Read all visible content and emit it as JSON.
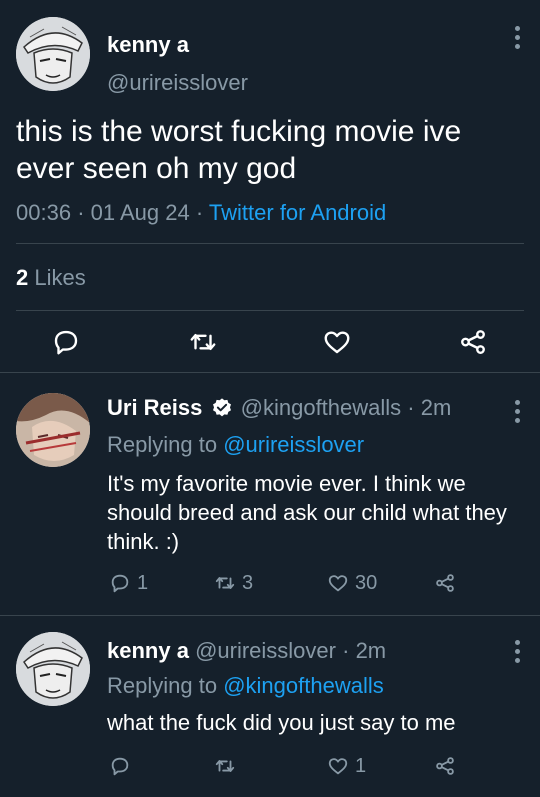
{
  "main_tweet": {
    "author_name": "kenny a",
    "author_handle": "@urireisslover",
    "text": "this is the worst fucking movie ive ever seen oh my god",
    "time": "00:36",
    "date": "01 Aug 24",
    "source": "Twitter for Android",
    "likes_count": "2",
    "likes_label": "Likes"
  },
  "replies": [
    {
      "author_name": "Uri Reiss",
      "verified": true,
      "author_handle": "@kingofthewalls",
      "age": "2m",
      "replying_prefix": "Replying to",
      "replying_to": "@urireisslover",
      "text": "It's my favorite movie ever. I think we should breed and ask our child what they think. :)",
      "reply_count": "1",
      "retweet_count": "3",
      "like_count": "30"
    },
    {
      "author_name": "kenny a",
      "author_handle": "@urireisslover",
      "age": "2m",
      "replying_prefix": "Replying to",
      "replying_to": "@kingofthewalls",
      "text": "what the fuck did you just say to me",
      "reply_count": "",
      "retweet_count": "",
      "like_count": "1"
    }
  ],
  "icons": {
    "reply": "reply-icon",
    "retweet": "retweet-icon",
    "like": "heart-icon",
    "share": "share-icon",
    "menu": "more-vertical-icon",
    "verified": "verified-badge-icon"
  },
  "colors": {
    "background": "#15202b",
    "text": "#ffffff",
    "secondary": "#8899a6",
    "accent": "#1da1f2",
    "divider": "#38444d"
  }
}
